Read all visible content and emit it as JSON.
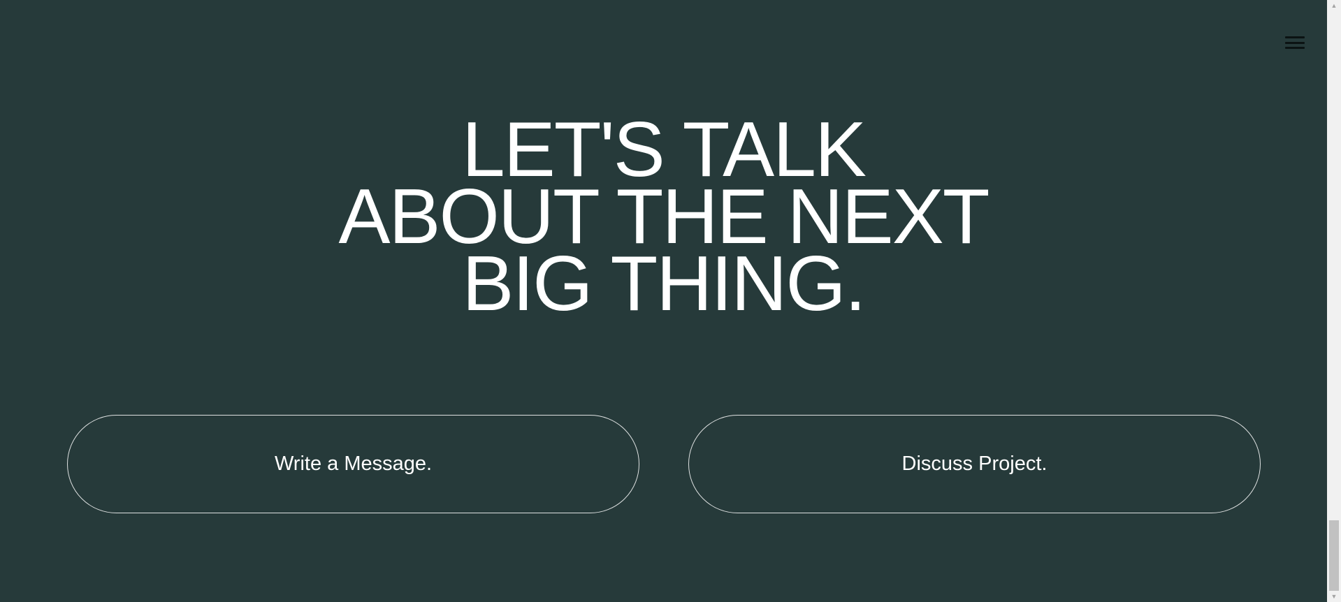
{
  "menu": {
    "icon": "hamburger-menu-icon"
  },
  "hero": {
    "line1": "LET'S TALK",
    "line2": "ABOUT THE NEXT",
    "line3": "BIG THING."
  },
  "actions": {
    "write_message": "Write a Message.",
    "discuss_project": "Discuss Project."
  },
  "scrollbar": {
    "up_icon": "▲",
    "down_icon": "▼",
    "scroll_position": 0.95
  },
  "colors": {
    "background": "#263a3a",
    "text": "#ffffff",
    "border": "#ffffff"
  }
}
